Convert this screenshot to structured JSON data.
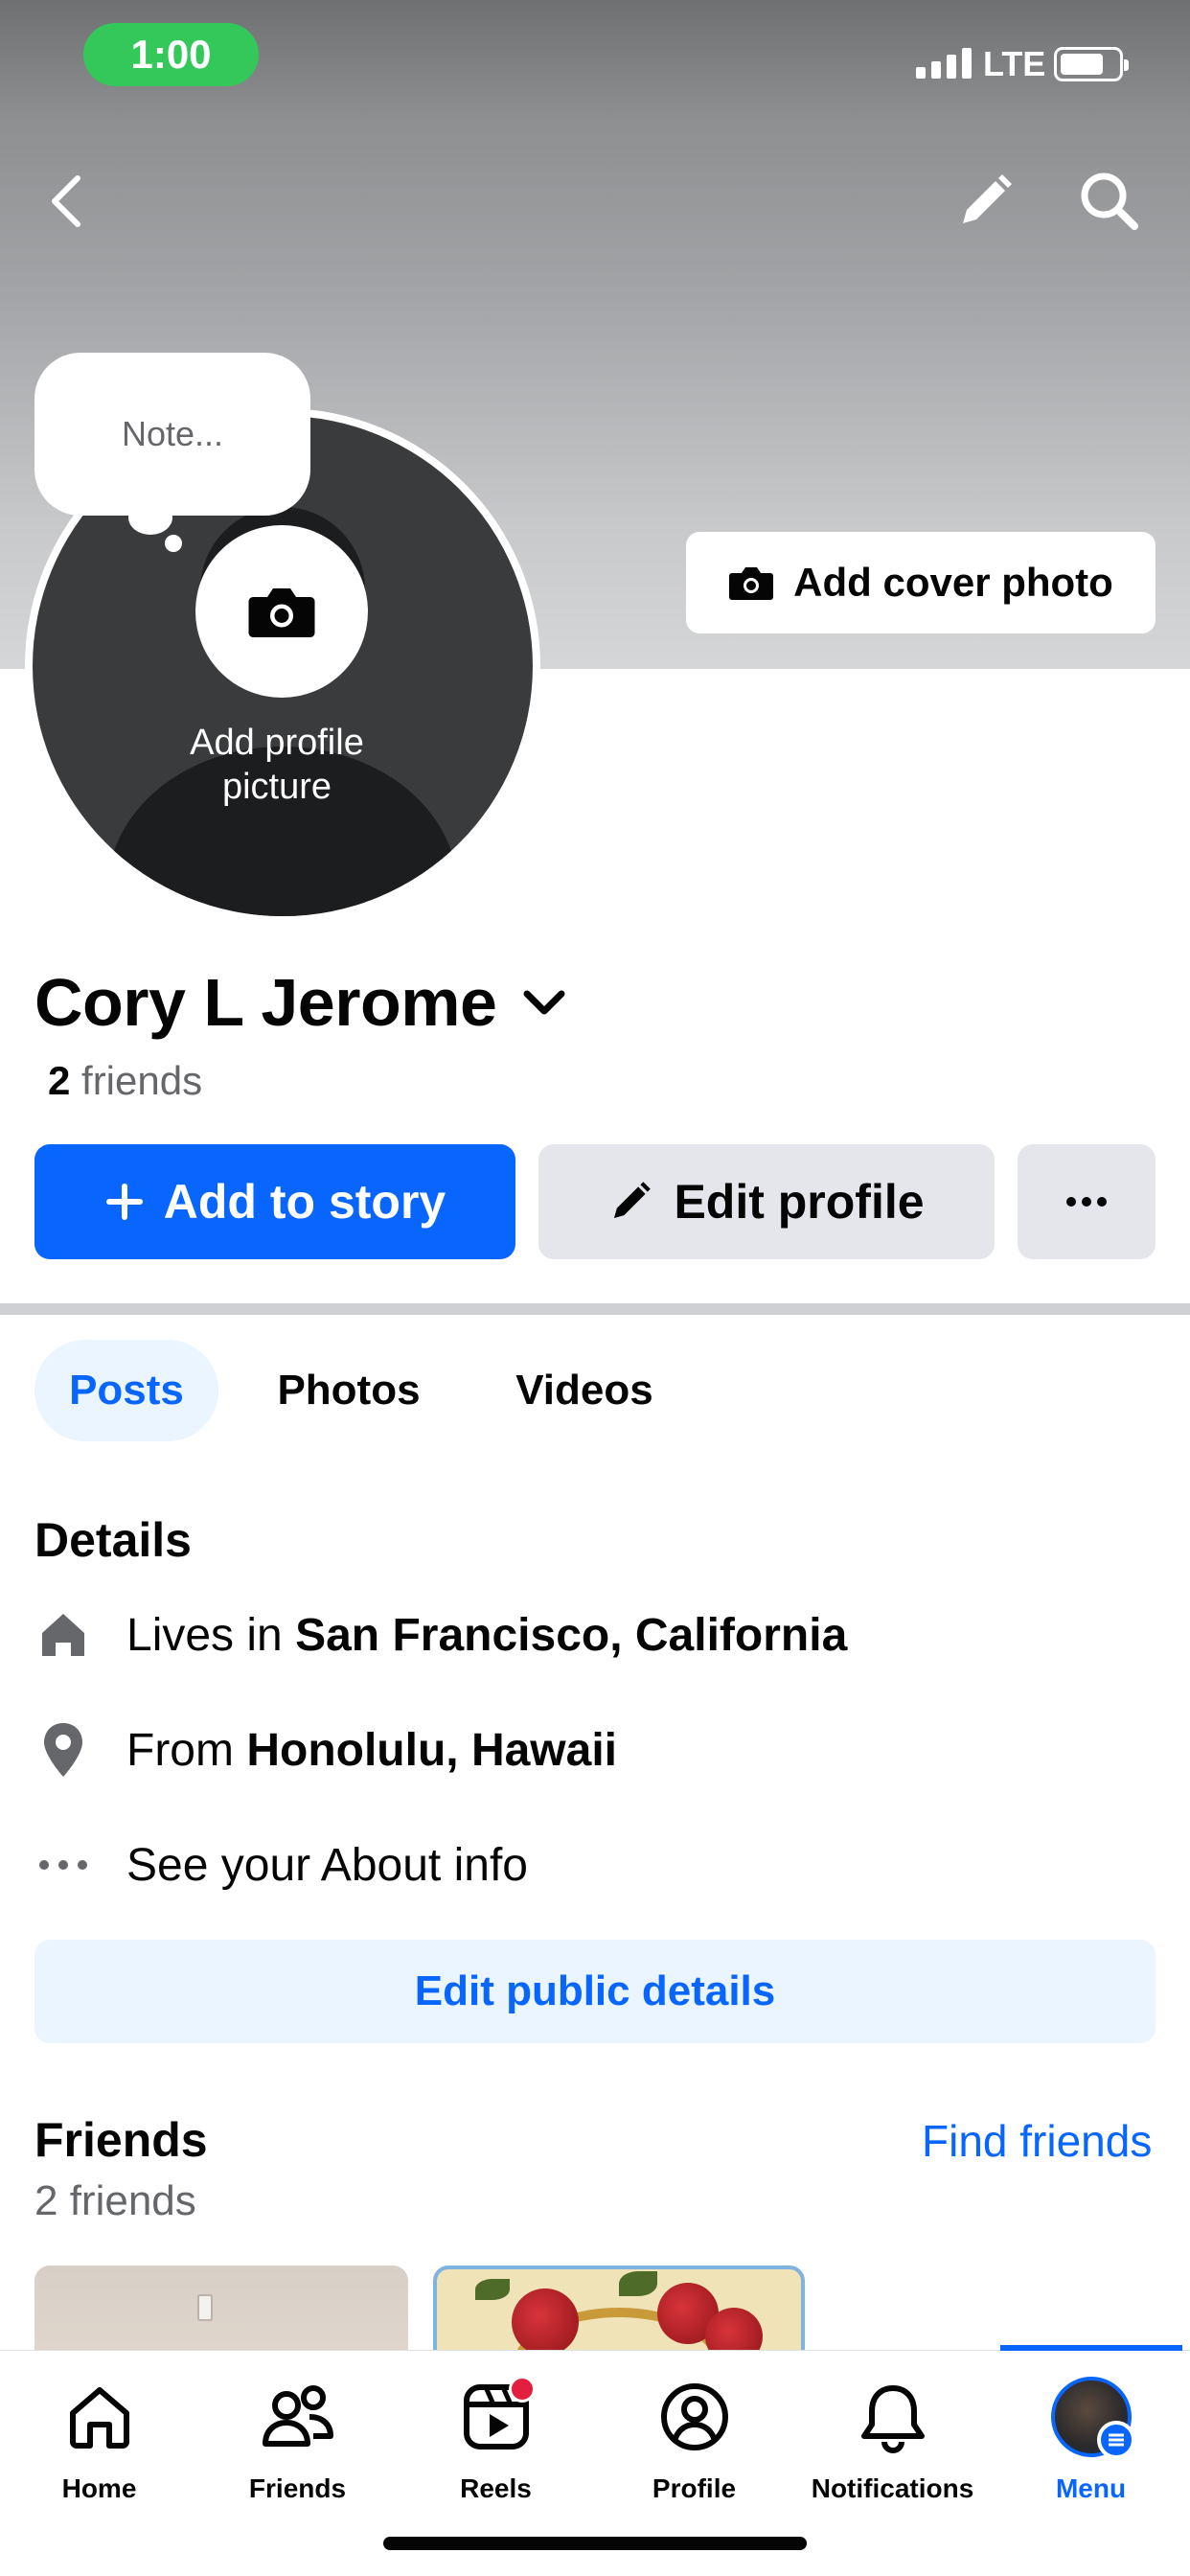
{
  "status_bar": {
    "time": "1:00",
    "network": "LTE"
  },
  "cover": {
    "add_cover_label": "Add cover photo"
  },
  "profile_picture": {
    "add_label": "Add profile picture",
    "note_placeholder": "Note..."
  },
  "profile": {
    "name": "Cory L Jerome",
    "friends_count": "2",
    "friends_word": "friends"
  },
  "actions": {
    "add_to_story": "Add to story",
    "edit_profile": "Edit profile"
  },
  "tabs": [
    {
      "label": "Posts",
      "active": true
    },
    {
      "label": "Photos",
      "active": false
    },
    {
      "label": "Videos",
      "active": false
    }
  ],
  "details": {
    "title": "Details",
    "lives_in_prefix": "Lives in",
    "lives_in_value": "San Francisco, California",
    "from_prefix": "From",
    "from_value": "Honolulu, Hawaii",
    "about": "See your About info",
    "edit_public": "Edit public details"
  },
  "friends_section": {
    "title": "Friends",
    "find": "Find friends",
    "subtitle": "2 friends"
  },
  "bottom_nav": [
    {
      "label": "Home",
      "icon": "home-icon"
    },
    {
      "label": "Friends",
      "icon": "friends-icon"
    },
    {
      "label": "Reels",
      "icon": "reels-icon"
    },
    {
      "label": "Profile",
      "icon": "profile-icon"
    },
    {
      "label": "Notifications",
      "icon": "bell-icon"
    },
    {
      "label": "Menu",
      "icon": "menu-avatar",
      "active": true
    }
  ],
  "colors": {
    "accent": "#0866ff",
    "status_green": "#34c759",
    "badge_red": "#e41e3f"
  }
}
